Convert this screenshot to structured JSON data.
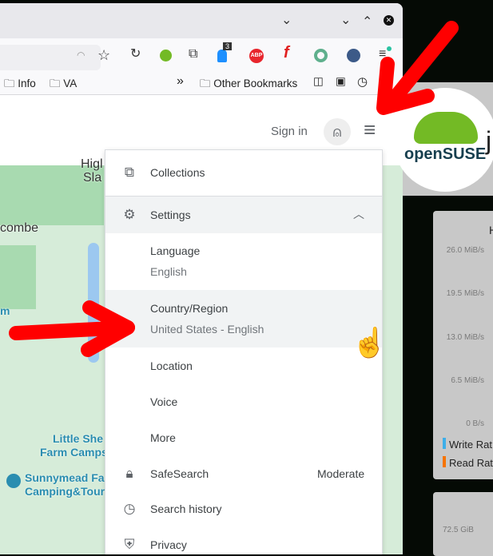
{
  "browser": {
    "bookmarks": [
      "Info",
      "VA"
    ],
    "other_bookmarks": "Other Bookmarks",
    "overflow": "»",
    "badge_count": "3",
    "abp": "ABP"
  },
  "header": {
    "sign_in": "Sign in"
  },
  "map": {
    "labels": [
      "Higl",
      "Sla",
      "combe",
      "m",
      "Little She",
      "Farm Camps",
      "Sunnymead Fa",
      "Camping&Tour"
    ]
  },
  "menu": {
    "collections": "Collections",
    "settings": "Settings",
    "language": {
      "label": "Language",
      "value": "English"
    },
    "country": {
      "label": "Country/Region",
      "value": "United States - English"
    },
    "location": "Location",
    "voice": "Voice",
    "more": "More",
    "safesearch": {
      "label": "SafeSearch",
      "value": "Moderate"
    },
    "history": "Search history",
    "privacy": "Privacy"
  },
  "right": {
    "logo": "openSUSE",
    "title_char": "j",
    "chart_title_char": "H",
    "yticks": [
      "26.0 MiB/s",
      "19.5 MiB/s",
      "13.0 MiB/s",
      "6.5 MiB/s",
      "0 B/s"
    ],
    "legend": [
      {
        "name": "Write Rat",
        "color": "#3daee9"
      },
      {
        "name": "Read Rat",
        "color": "#f67400"
      }
    ],
    "card2_tick": "72.5 GiB"
  },
  "colors": {
    "arrow": "#ff0000",
    "accent": "#1a73e8"
  }
}
